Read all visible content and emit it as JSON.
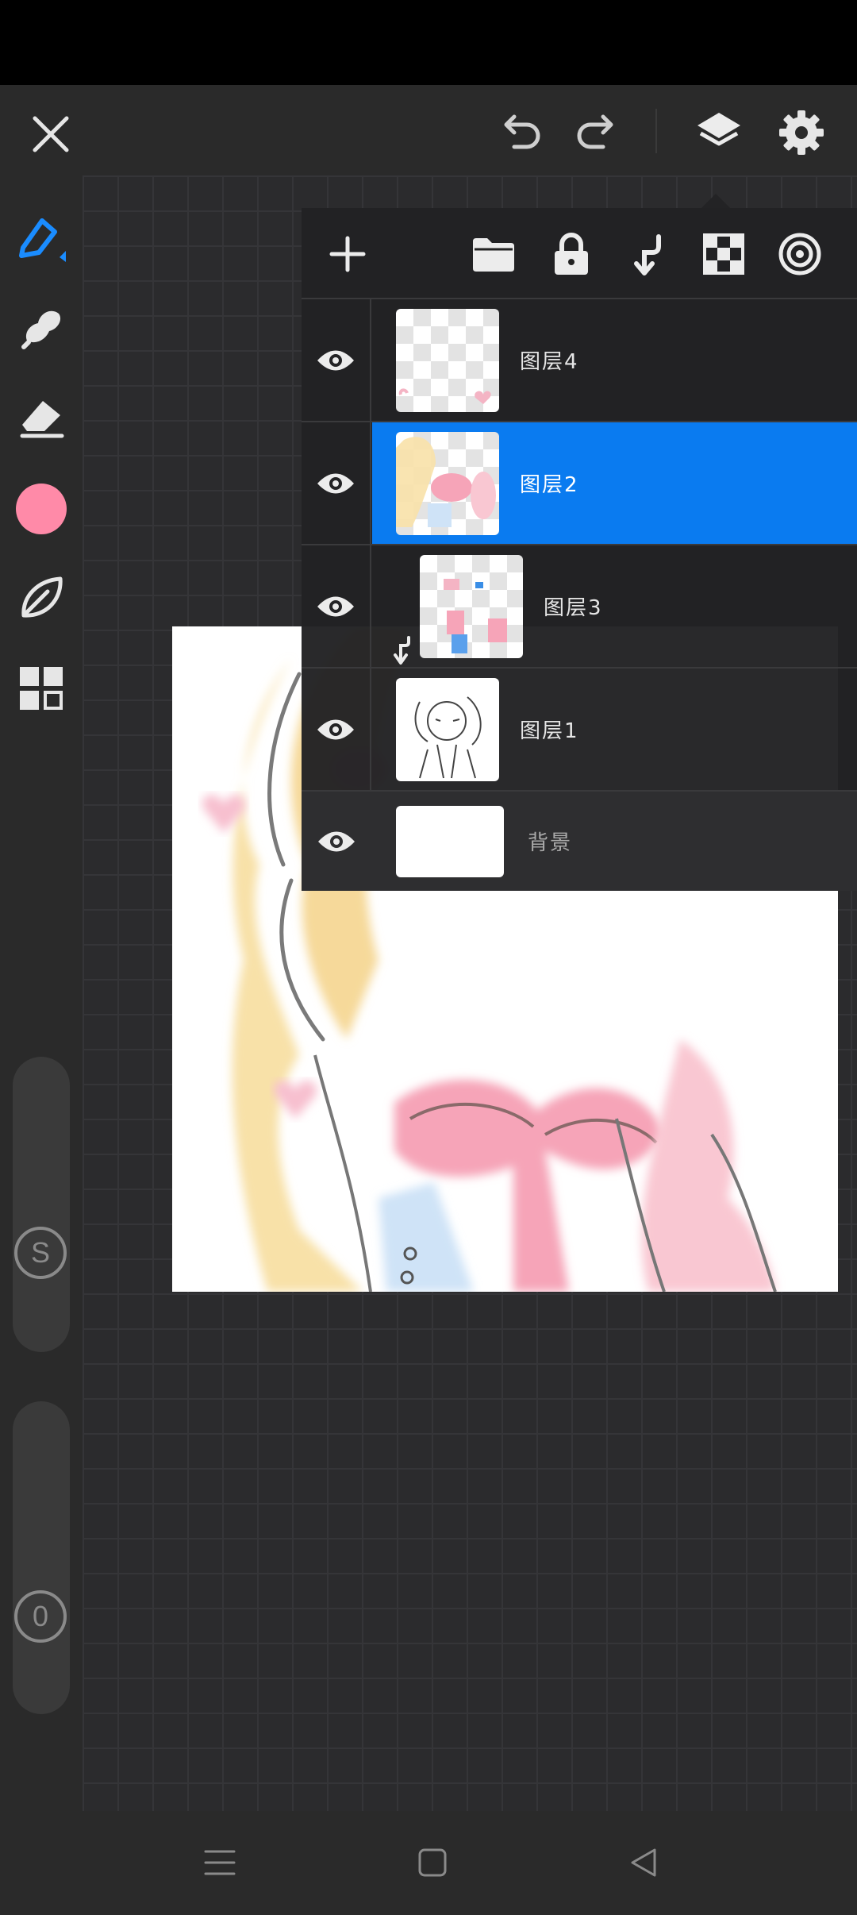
{
  "topbar": {
    "close_icon": "close-icon",
    "undo_icon": "undo-icon",
    "redo_icon": "redo-icon",
    "layers_icon": "layers-icon",
    "settings_icon": "gear-icon"
  },
  "tools": [
    {
      "name": "pen",
      "icon": "pen-icon",
      "active": true
    },
    {
      "name": "smudge",
      "icon": "smudge-icon"
    },
    {
      "name": "eraser",
      "icon": "eraser-icon"
    },
    {
      "name": "color",
      "icon": "color-swatch",
      "color": "#ff8aa8"
    },
    {
      "name": "brush-library",
      "icon": "leaf-icon"
    },
    {
      "name": "more",
      "icon": "grid-icon"
    }
  ],
  "sliders": {
    "size_label": "S",
    "opacity_label": "0"
  },
  "layers_toolbar": [
    "add-icon",
    "folder-icon",
    "lock-icon",
    "clip-icon",
    "checker-icon",
    "target-icon"
  ],
  "layers": [
    {
      "name": "图层4",
      "visible": true,
      "selected": false,
      "clipped": false
    },
    {
      "name": "图层2",
      "visible": true,
      "selected": true,
      "clipped": false
    },
    {
      "name": "图层3",
      "visible": true,
      "selected": false,
      "clipped": true
    },
    {
      "name": "图层1",
      "visible": true,
      "selected": false,
      "clipped": false
    },
    {
      "name": "背景",
      "visible": true,
      "selected": false,
      "clipped": false
    }
  ],
  "colors": {
    "accent": "#0a7bf0",
    "brush": "#ff8aa8",
    "panel": "#232325",
    "bar": "#2a2a2a"
  },
  "navbar": [
    "menu-icon",
    "home-icon",
    "back-icon"
  ]
}
